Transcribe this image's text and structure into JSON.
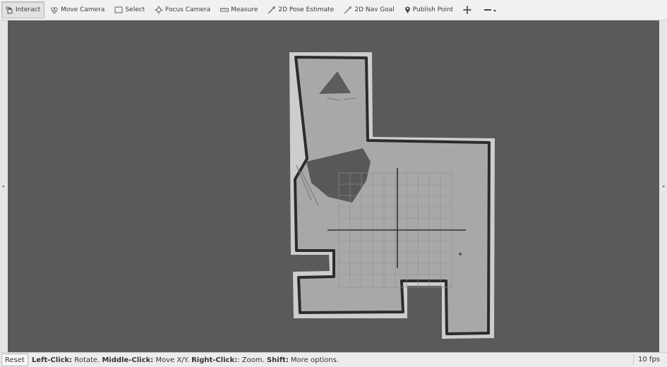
{
  "toolbar": {
    "tools": [
      {
        "label": "Interact",
        "icon": "hand-icon"
      },
      {
        "label": "Move Camera",
        "icon": "move-camera-icon"
      },
      {
        "label": "Select",
        "icon": "select-rectangle-icon"
      },
      {
        "label": "Focus Camera",
        "icon": "focus-camera-icon"
      },
      {
        "label": "Measure",
        "icon": "ruler-icon"
      },
      {
        "label": "2D Pose Estimate",
        "icon": "pose-arrow-icon"
      },
      {
        "label": "2D Nav Goal",
        "icon": "nav-goal-arrow-icon"
      },
      {
        "label": "Publish Point",
        "icon": "map-pin-icon"
      }
    ],
    "active_tool": "Interact"
  },
  "viewport": {
    "background_color": "#5a5a5a",
    "map_free_color": "#a8a8a8",
    "map_wall_color": "#2e2e2e",
    "grid_color": "#8e8e8e"
  },
  "statusbar": {
    "reset_label": "Reset",
    "help_parts": {
      "k1": "Left-Click:",
      "v1": " Rotate. ",
      "k2": "Middle-Click:",
      "v2": " Move X/Y. ",
      "k3": "Right-Click:",
      "v3": ": Zoom. ",
      "k4": "Shift:",
      "v4": " More options."
    },
    "fps": "10 fps"
  }
}
